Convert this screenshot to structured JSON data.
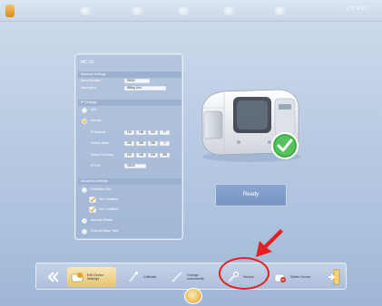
{
  "topbar": {
    "brand": "CEREC"
  },
  "panel": {
    "title": "MC XL",
    "machine_settings": {
      "header": "Machine Settings",
      "serial_label": "Serial Number",
      "serial_value": "00000",
      "description_label": "Description",
      "description_value": "Milling Unit"
    },
    "ip_settings": {
      "header": "IP Settings",
      "auto_label": "Auto",
      "manual_label": "Manual",
      "ip_address_label": "IP Address",
      "ip_address": [
        "192",
        "168",
        "200",
        "77"
      ],
      "subnet_label": "Subnet Mask",
      "subnet": [
        "255",
        "255",
        "255",
        "0"
      ],
      "gateway_label": "Default Gateway",
      "gateway": [
        "192",
        "168",
        "200",
        "283"
      ],
      "port_label": "IP Port",
      "port_value": "20000"
    },
    "advanced_settings": {
      "header": "Advanced Settings",
      "extraction_label": "Extraction Unit",
      "set1_label": "Set 1 enabled",
      "set2_label": "Set 2 enabled",
      "barcode_label": "Barcode Reader",
      "water_tank_label": "External Water Tank"
    }
  },
  "status": {
    "ready_label": "Ready"
  },
  "toolbar": {
    "edit_device": "Edit Device Settings",
    "calibrate": "Calibrate",
    "change_tools": "Change instruments",
    "service": "Service",
    "delete_device": "Delete Device"
  },
  "colors": {
    "annotation_red": "#e41f1f",
    "active_button": "#e6c36d",
    "check_green": "#3fae49"
  }
}
